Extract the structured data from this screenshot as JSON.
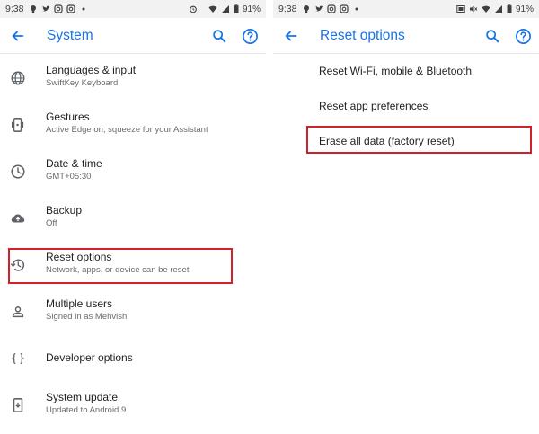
{
  "status_left": {
    "time": "9:38",
    "battery": "91%"
  },
  "status_right": {
    "time": "9:38",
    "battery": "91%"
  },
  "left_screen": {
    "title": "System",
    "items": [
      {
        "title": "Languages & input",
        "subtitle": "SwiftKey Keyboard",
        "icon": "globe-icon"
      },
      {
        "title": "Gestures",
        "subtitle": "Active Edge on, squeeze for your Assistant",
        "icon": "gestures-phone-icon"
      },
      {
        "title": "Date & time",
        "subtitle": "GMT+05:30",
        "icon": "clock-icon"
      },
      {
        "title": "Backup",
        "subtitle": "Off",
        "icon": "cloud-upload-icon"
      },
      {
        "title": "Reset options",
        "subtitle": "Network, apps, or device can be reset",
        "icon": "history-icon"
      },
      {
        "title": "Multiple users",
        "subtitle": "Signed in as Mehvish",
        "icon": "person-icon"
      },
      {
        "title": "Developer options",
        "subtitle": "",
        "icon": "braces-icon"
      },
      {
        "title": "System update",
        "subtitle": "Updated to Android 9",
        "icon": "system-update-icon"
      }
    ]
  },
  "right_screen": {
    "title": "Reset options",
    "items": [
      {
        "title": "Reset Wi-Fi, mobile & Bluetooth"
      },
      {
        "title": "Reset app preferences"
      },
      {
        "title": "Erase all data (factory reset)"
      }
    ]
  },
  "colors": {
    "accent": "#1a73e8",
    "highlight": "#d0202a",
    "status_bar": "#f2f2f2",
    "icon": "#5f6368"
  }
}
